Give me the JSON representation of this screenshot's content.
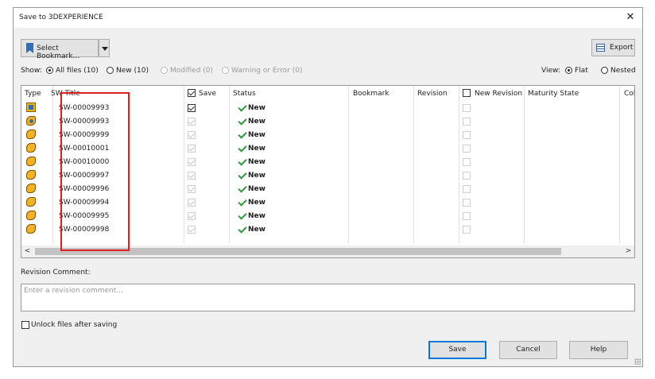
{
  "window": {
    "title": "Save to 3DEXPERIENCE"
  },
  "toolbar": {
    "select_bookmark_label": "Select Bookmark...",
    "export_label": "Export"
  },
  "show": {
    "label": "Show:",
    "options": [
      {
        "label": "All files (10)",
        "checked": true,
        "enabled": true
      },
      {
        "label": "New (10)",
        "checked": false,
        "enabled": true
      },
      {
        "label": "Modified (0)",
        "checked": false,
        "enabled": false
      },
      {
        "label": "Warning or Error (0)",
        "checked": false,
        "enabled": false
      }
    ]
  },
  "view": {
    "label": "View:",
    "options": [
      {
        "label": "Flat",
        "checked": true
      },
      {
        "label": "Nested",
        "checked": false
      }
    ]
  },
  "table": {
    "columns": {
      "type": "Type",
      "sw_title": "SW Title",
      "save": "Save",
      "status": "Status",
      "bookmark": "Bookmark",
      "revision": "Revision",
      "new_revision": "New Revision",
      "maturity_state": "Maturity State",
      "collab": "Colla"
    },
    "rows": [
      {
        "type": "assembly",
        "title": "SW-00009993",
        "save": true,
        "save_enabled": true,
        "status": "New"
      },
      {
        "type": "part-blue",
        "title": "SW-00009993",
        "save": true,
        "save_enabled": false,
        "status": "New"
      },
      {
        "type": "part",
        "title": "SW-00009999",
        "save": true,
        "save_enabled": false,
        "status": "New"
      },
      {
        "type": "part",
        "title": "SW-00010001",
        "save": true,
        "save_enabled": false,
        "status": "New"
      },
      {
        "type": "part",
        "title": "SW-00010000",
        "save": true,
        "save_enabled": false,
        "status": "New"
      },
      {
        "type": "part",
        "title": "SW-00009997",
        "save": true,
        "save_enabled": false,
        "status": "New"
      },
      {
        "type": "part",
        "title": "SW-00009996",
        "save": true,
        "save_enabled": false,
        "status": "New"
      },
      {
        "type": "part",
        "title": "SW-00009994",
        "save": true,
        "save_enabled": false,
        "status": "New"
      },
      {
        "type": "part",
        "title": "SW-00009995",
        "save": true,
        "save_enabled": false,
        "status": "New"
      },
      {
        "type": "part",
        "title": "SW-00009998",
        "save": true,
        "save_enabled": false,
        "status": "New"
      }
    ]
  },
  "revision_comment": {
    "label": "Revision Comment:",
    "placeholder": "Enter a revision comment..."
  },
  "unlock": {
    "label": "Unlock files after saving",
    "checked": false
  },
  "buttons": {
    "save": "Save",
    "cancel": "Cancel",
    "help": "Help"
  },
  "colors": {
    "highlight": "#e02020",
    "status_new": "#2e9a3b",
    "default_button": "#0078d7"
  }
}
